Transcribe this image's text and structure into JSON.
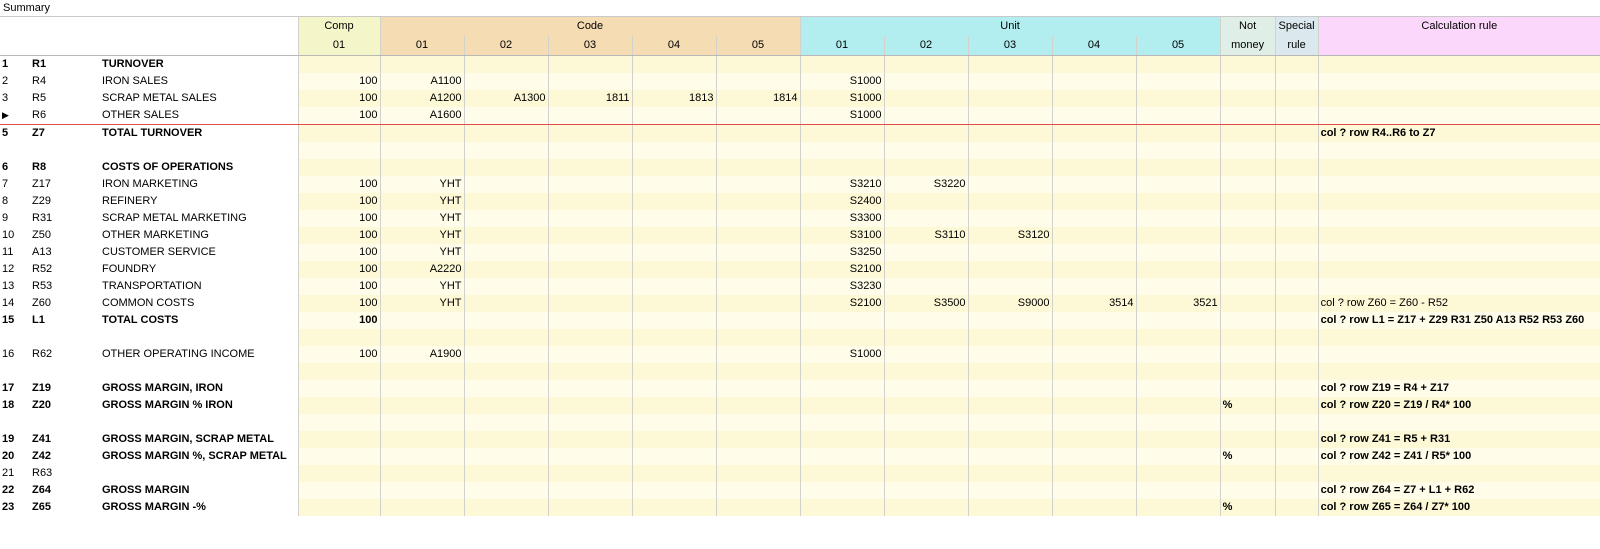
{
  "window": {
    "title": "Summary"
  },
  "headers": {
    "groups": {
      "comp": "Comp",
      "code": "Code",
      "unit": "Unit",
      "not_money_1": "Not",
      "special_1": "Special",
      "calc": "Calculation rule"
    },
    "sub": {
      "comp": "01",
      "code": [
        "01",
        "02",
        "03",
        "04",
        "05"
      ],
      "unit": [
        "01",
        "02",
        "03",
        "04",
        "05"
      ],
      "not_money_2": "money",
      "special_2": "rule"
    }
  },
  "rows": [
    {
      "no": "1",
      "id": "R1",
      "name": "TURNOVER",
      "comp": "",
      "code": [
        "",
        "",
        "",
        "",
        ""
      ],
      "unit": [
        "",
        "",
        "",
        "",
        ""
      ],
      "not_money": "",
      "special": "",
      "calc": "",
      "bold": true
    },
    {
      "no": "2",
      "id": "R4",
      "name": "IRON SALES",
      "comp": "100",
      "code": [
        "A1100",
        "",
        "",
        "",
        ""
      ],
      "unit": [
        "S1000",
        "",
        "",
        "",
        ""
      ],
      "not_money": "",
      "special": "",
      "calc": "",
      "bold": false
    },
    {
      "no": "3",
      "id": "R5",
      "name": "SCRAP METAL SALES",
      "comp": "100",
      "code": [
        "A1200",
        "A1300",
        "1811",
        "1813",
        "1814"
      ],
      "unit": [
        "S1000",
        "",
        "",
        "",
        ""
      ],
      "not_money": "",
      "special": "",
      "calc": "",
      "bold": false
    },
    {
      "no": "▶",
      "id": "R6",
      "name": "OTHER SALES",
      "comp": "100",
      "code": [
        "A1600",
        "",
        "",
        "",
        ""
      ],
      "unit": [
        "S1000",
        "",
        "",
        "",
        ""
      ],
      "not_money": "",
      "special": "",
      "calc": "",
      "bold": false,
      "current": true
    },
    {
      "no": "5",
      "id": "Z7",
      "name": "TOTAL TURNOVER",
      "comp": "",
      "code": [
        "",
        "",
        "",
        "",
        ""
      ],
      "unit": [
        "",
        "",
        "",
        "",
        ""
      ],
      "not_money": "",
      "special": "",
      "calc": "col ? row R4..R6 to Z7",
      "bold": true
    },
    {
      "no": "",
      "id": "",
      "name": "",
      "comp": "",
      "code": [
        "",
        "",
        "",
        "",
        ""
      ],
      "unit": [
        "",
        "",
        "",
        "",
        ""
      ],
      "not_money": "",
      "special": "",
      "calc": "",
      "bold": false,
      "empty": true
    },
    {
      "no": "6",
      "id": "R8",
      "name": "COSTS OF OPERATIONS",
      "comp": "",
      "code": [
        "",
        "",
        "",
        "",
        ""
      ],
      "unit": [
        "",
        "",
        "",
        "",
        ""
      ],
      "not_money": "",
      "special": "",
      "calc": "",
      "bold": true
    },
    {
      "no": "7",
      "id": "Z17",
      "name": "IRON MARKETING",
      "comp": "100",
      "code": [
        "YHT",
        "",
        "",
        "",
        ""
      ],
      "unit": [
        "S3210",
        "S3220",
        "",
        "",
        ""
      ],
      "not_money": "",
      "special": "",
      "calc": "",
      "bold": false
    },
    {
      "no": "8",
      "id": "Z29",
      "name": "REFINERY",
      "comp": "100",
      "code": [
        "YHT",
        "",
        "",
        "",
        ""
      ],
      "unit": [
        "S2400",
        "",
        "",
        "",
        ""
      ],
      "not_money": "",
      "special": "",
      "calc": "",
      "bold": false
    },
    {
      "no": "9",
      "id": "R31",
      "name": "SCRAP METAL MARKETING",
      "comp": "100",
      "code": [
        "YHT",
        "",
        "",
        "",
        ""
      ],
      "unit": [
        "S3300",
        "",
        "",
        "",
        ""
      ],
      "not_money": "",
      "special": "",
      "calc": "",
      "bold": false
    },
    {
      "no": "10",
      "id": "Z50",
      "name": "OTHER MARKETING",
      "comp": "100",
      "code": [
        "YHT",
        "",
        "",
        "",
        ""
      ],
      "unit": [
        "S3100",
        "S3110",
        "S3120",
        "",
        ""
      ],
      "not_money": "",
      "special": "",
      "calc": "",
      "bold": false
    },
    {
      "no": "11",
      "id": "A13",
      "name": "CUSTOMER SERVICE",
      "comp": "100",
      "code": [
        "YHT",
        "",
        "",
        "",
        ""
      ],
      "unit": [
        "S3250",
        "",
        "",
        "",
        ""
      ],
      "not_money": "",
      "special": "",
      "calc": "",
      "bold": false
    },
    {
      "no": "12",
      "id": "R52",
      "name": "FOUNDRY",
      "comp": "100",
      "code": [
        "A2220",
        "",
        "",
        "",
        ""
      ],
      "unit": [
        "S2100",
        "",
        "",
        "",
        ""
      ],
      "not_money": "",
      "special": "",
      "calc": "",
      "bold": false
    },
    {
      "no": "13",
      "id": "R53",
      "name": "TRANSPORTATION",
      "comp": "100",
      "code": [
        "YHT",
        "",
        "",
        "",
        ""
      ],
      "unit": [
        "S3230",
        "",
        "",
        "",
        ""
      ],
      "not_money": "",
      "special": "",
      "calc": "",
      "bold": false
    },
    {
      "no": "14",
      "id": "Z60",
      "name": "COMMON COSTS",
      "comp": "100",
      "code": [
        "YHT",
        "",
        "",
        "",
        ""
      ],
      "unit": [
        "S2100",
        "S3500",
        "S9000",
        "3514",
        "3521"
      ],
      "not_money": "",
      "special": "",
      "calc": "col ? row Z60 = Z60 - R52",
      "bold": false
    },
    {
      "no": "15",
      "id": "L1",
      "name": "TOTAL COSTS",
      "comp": "100",
      "code": [
        "",
        "",
        "",
        "",
        ""
      ],
      "unit": [
        "",
        "",
        "",
        "",
        ""
      ],
      "not_money": "",
      "special": "",
      "calc": "col ?  row L1 = Z17 + Z29 R31 Z50 A13 R52 R53 Z60",
      "bold": true
    },
    {
      "no": "",
      "id": "",
      "name": "",
      "comp": "",
      "code": [
        "",
        "",
        "",
        "",
        ""
      ],
      "unit": [
        "",
        "",
        "",
        "",
        ""
      ],
      "not_money": "",
      "special": "",
      "calc": "",
      "bold": false,
      "empty": true
    },
    {
      "no": "16",
      "id": "R62",
      "name": "OTHER OPERATING INCOME",
      "comp": "100",
      "code": [
        "A1900",
        "",
        "",
        "",
        ""
      ],
      "unit": [
        "S1000",
        "",
        "",
        "",
        ""
      ],
      "not_money": "",
      "special": "",
      "calc": "",
      "bold": false
    },
    {
      "no": "",
      "id": "",
      "name": "",
      "comp": "",
      "code": [
        "",
        "",
        "",
        "",
        ""
      ],
      "unit": [
        "",
        "",
        "",
        "",
        ""
      ],
      "not_money": "",
      "special": "",
      "calc": "",
      "bold": false,
      "empty": true
    },
    {
      "no": "17",
      "id": "Z19",
      "name": "GROSS MARGIN, IRON",
      "comp": "",
      "code": [
        "",
        "",
        "",
        "",
        ""
      ],
      "unit": [
        "",
        "",
        "",
        "",
        ""
      ],
      "not_money": "",
      "special": "",
      "calc": "col ? row Z19 = R4 + Z17",
      "bold": true
    },
    {
      "no": "18",
      "id": "Z20",
      "name": "GROSS MARGIN % IRON",
      "comp": "",
      "code": [
        "",
        "",
        "",
        "",
        ""
      ],
      "unit": [
        "",
        "",
        "",
        "",
        ""
      ],
      "not_money": "%",
      "special": "",
      "calc": "col ? row Z20 = Z19 / R4* 100",
      "bold": true
    },
    {
      "no": "",
      "id": "",
      "name": "",
      "comp": "",
      "code": [
        "",
        "",
        "",
        "",
        ""
      ],
      "unit": [
        "",
        "",
        "",
        "",
        ""
      ],
      "not_money": "",
      "special": "",
      "calc": "",
      "bold": false,
      "empty": true
    },
    {
      "no": "19",
      "id": "Z41",
      "name": "GROSS MARGIN, SCRAP METAL",
      "comp": "",
      "code": [
        "",
        "",
        "",
        "",
        ""
      ],
      "unit": [
        "",
        "",
        "",
        "",
        ""
      ],
      "not_money": "",
      "special": "",
      "calc": "col ? row Z41 = R5 + R31",
      "bold": true
    },
    {
      "no": "20",
      "id": "Z42",
      "name": "GROSS MARGIN %, SCRAP METAL",
      "comp": "",
      "code": [
        "",
        "",
        "",
        "",
        ""
      ],
      "unit": [
        "",
        "",
        "",
        "",
        ""
      ],
      "not_money": "%",
      "special": "",
      "calc": "col ? row Z42 = Z41 / R5* 100",
      "bold": true
    },
    {
      "no": "21",
      "id": "R63",
      "name": "",
      "comp": "",
      "code": [
        "",
        "",
        "",
        "",
        ""
      ],
      "unit": [
        "",
        "",
        "",
        "",
        ""
      ],
      "not_money": "",
      "special": "",
      "calc": "",
      "bold": false
    },
    {
      "no": "22",
      "id": "Z64",
      "name": "GROSS MARGIN",
      "comp": "",
      "code": [
        "",
        "",
        "",
        "",
        ""
      ],
      "unit": [
        "",
        "",
        "",
        "",
        ""
      ],
      "not_money": "",
      "special": "",
      "calc": "col ? row Z64 = Z7 + L1 + R62",
      "bold": true
    },
    {
      "no": "23",
      "id": "Z65",
      "name": "GROSS MARGIN -%",
      "comp": "",
      "code": [
        "",
        "",
        "",
        "",
        ""
      ],
      "unit": [
        "",
        "",
        "",
        "",
        ""
      ],
      "not_money": "%",
      "special": "",
      "calc": "col ? row Z65 = Z64 / Z7* 100",
      "bold": true
    }
  ]
}
